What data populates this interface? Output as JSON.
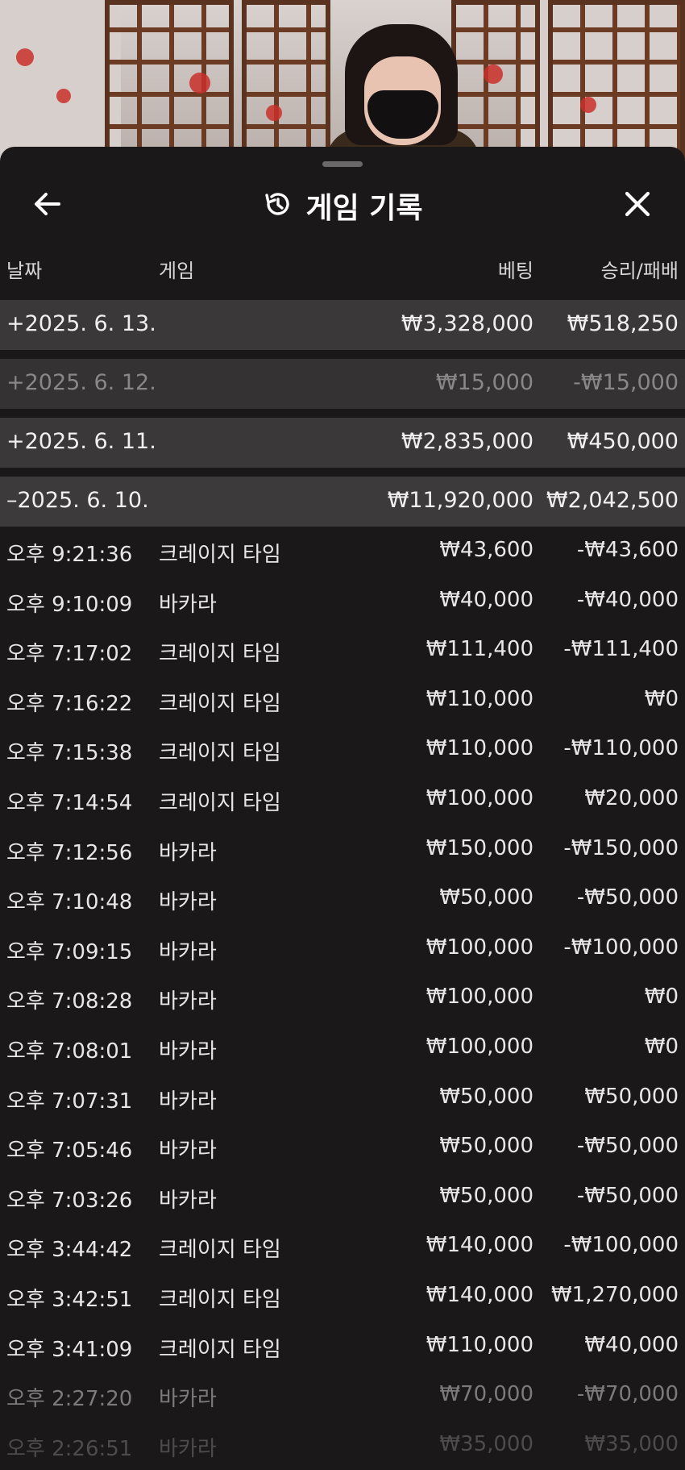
{
  "header": {
    "title": "게임 기록",
    "back_icon": "arrow-left-icon",
    "history_icon": "history-icon",
    "close_icon": "close-icon"
  },
  "columns": {
    "date": "날짜",
    "game": "게임",
    "bet": "베팅",
    "result": "승리/패배"
  },
  "days": [
    {
      "date": "+2025. 6. 13.",
      "bet": "₩3,328,000",
      "result": "₩518,250"
    },
    {
      "date": "+2025. 6. 12.",
      "bet": "₩15,000",
      "result": "-₩15,000"
    },
    {
      "date": "+2025. 6. 11.",
      "bet": "₩2,835,000",
      "result": "₩450,000"
    },
    {
      "date": "–2025. 6. 10.",
      "bet": "₩11,920,000",
      "result": "₩2,042,500"
    }
  ],
  "transactions": [
    {
      "time": "오후 9:21:36",
      "game": "크레이지 타임",
      "bet": "₩43,600",
      "result": "-₩43,600"
    },
    {
      "time": "오후 9:10:09",
      "game": "바카라",
      "bet": "₩40,000",
      "result": "-₩40,000"
    },
    {
      "time": "오후 7:17:02",
      "game": "크레이지 타임",
      "bet": "₩111,400",
      "result": "-₩111,400"
    },
    {
      "time": "오후 7:16:22",
      "game": "크레이지 타임",
      "bet": "₩110,000",
      "result": "₩0"
    },
    {
      "time": "오후 7:15:38",
      "game": "크레이지 타임",
      "bet": "₩110,000",
      "result": "-₩110,000"
    },
    {
      "time": "오후 7:14:54",
      "game": "크레이지 타임",
      "bet": "₩100,000",
      "result": "₩20,000"
    },
    {
      "time": "오후 7:12:56",
      "game": "바카라",
      "bet": "₩150,000",
      "result": "-₩150,000"
    },
    {
      "time": "오후 7:10:48",
      "game": "바카라",
      "bet": "₩50,000",
      "result": "-₩50,000"
    },
    {
      "time": "오후 7:09:15",
      "game": "바카라",
      "bet": "₩100,000",
      "result": "-₩100,000"
    },
    {
      "time": "오후 7:08:28",
      "game": "바카라",
      "bet": "₩100,000",
      "result": "₩0"
    },
    {
      "time": "오후 7:08:01",
      "game": "바카라",
      "bet": "₩100,000",
      "result": "₩0"
    },
    {
      "time": "오후 7:07:31",
      "game": "바카라",
      "bet": "₩50,000",
      "result": "₩50,000"
    },
    {
      "time": "오후 7:05:46",
      "game": "바카라",
      "bet": "₩50,000",
      "result": "-₩50,000"
    },
    {
      "time": "오후 7:03:26",
      "game": "바카라",
      "bet": "₩50,000",
      "result": "-₩50,000"
    },
    {
      "time": "오후 3:44:42",
      "game": "크레이지 타임",
      "bet": "₩140,000",
      "result": "-₩100,000"
    },
    {
      "time": "오후 3:42:51",
      "game": "크레이지 타임",
      "bet": "₩140,000",
      "result": "₩1,270,000"
    },
    {
      "time": "오후 3:41:09",
      "game": "크레이지 타임",
      "bet": "₩110,000",
      "result": "₩40,000"
    },
    {
      "time": "오후 2:27:20",
      "game": "바카라",
      "bet": "₩70,000",
      "result": "-₩70,000"
    },
    {
      "time": "오후 2:26:51",
      "game": "바카라",
      "bet": "₩35,000",
      "result": "₩35,000"
    }
  ]
}
